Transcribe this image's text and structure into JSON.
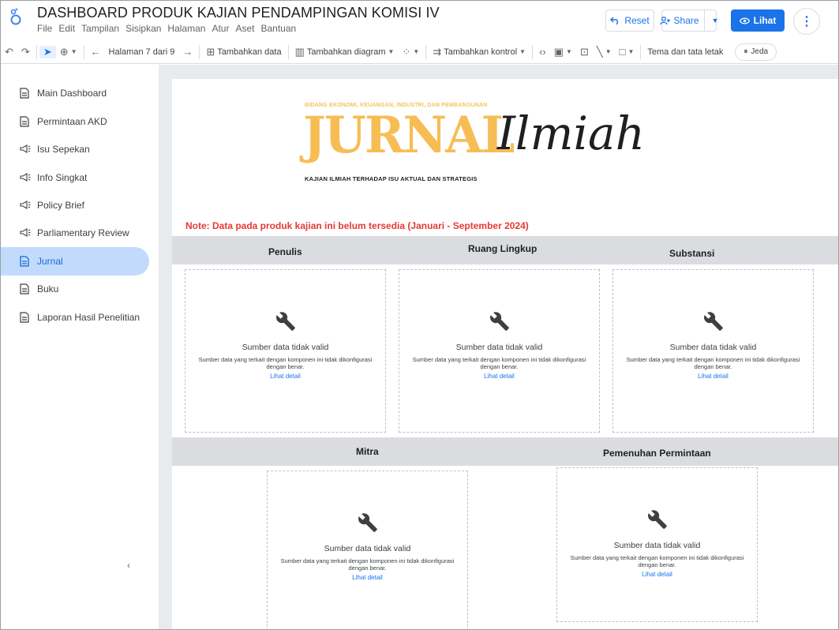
{
  "app": {
    "doc_title": "DASHBOARD PRODUK KAJIAN PENDAMPINGAN KOMISI IV",
    "menu": [
      "File",
      "Edit",
      "Tampilan",
      "Sisipkan",
      "Halaman",
      "Atur",
      "Aset",
      "Bantuan"
    ]
  },
  "header_actions": {
    "reset_label": "Reset",
    "share_label": "Share",
    "lihat_label": "Lihat"
  },
  "toolbar": {
    "page_indicator": "Halaman 7 dari 9",
    "add_data": "Tambahkan data",
    "add_chart": "Tambahkan diagram",
    "add_control": "Tambahkan kontrol",
    "theme_layout": "Tema dan tata letak",
    "jeda": "Jeda"
  },
  "sidebar": {
    "items": [
      {
        "label": "Main Dashboard",
        "icon": "document-icon",
        "active": false
      },
      {
        "label": "Permintaan AKD",
        "icon": "document-icon",
        "active": false
      },
      {
        "label": "Isu Sepekan",
        "icon": "megaphone-icon",
        "active": false
      },
      {
        "label": "Info Singkat",
        "icon": "megaphone-icon",
        "active": false
      },
      {
        "label": "Policy Brief",
        "icon": "megaphone-icon",
        "active": false
      },
      {
        "label": "Parliamentary Review",
        "icon": "megaphone-icon",
        "active": false
      },
      {
        "label": "Jurnal",
        "icon": "document-icon",
        "active": true
      },
      {
        "label": "Buku",
        "icon": "document-icon",
        "active": false
      },
      {
        "label": "Laporan Hasil Penelitian",
        "icon": "document-icon",
        "active": false
      }
    ]
  },
  "banner": {
    "subtitle": "BIDANG EKONOMI, KEUANGAN, INDUSTRI, DAN PEMBANGUNAN",
    "big": "JURNAL",
    "script": "Ilmiah",
    "tagline": "KAJIAN ILMIAH TERHADAP ISU AKTUAL DAN STRATEGIS",
    "big_color": "#f7bd55"
  },
  "note": "Note: Data pada produk kajian ini belum tersedia (Januari - September 2024)",
  "sections": {
    "row1": [
      "Penulis",
      "Ruang Lingkup",
      "Substansi"
    ],
    "row2": [
      "Mitra",
      "Pemenuhan Permintaan"
    ]
  },
  "widget": {
    "title": "Sumber data tidak valid",
    "desc": "Sumber data yang terkait dengan komponen ini tidak dikonfigurasi dengan benar.",
    "link": "Lihat detail",
    "icon": "wrench-icon"
  },
  "colors": {
    "accent": "#1a73e8",
    "active_nav_bg": "#c2dbfd",
    "note_red": "#e53935"
  }
}
